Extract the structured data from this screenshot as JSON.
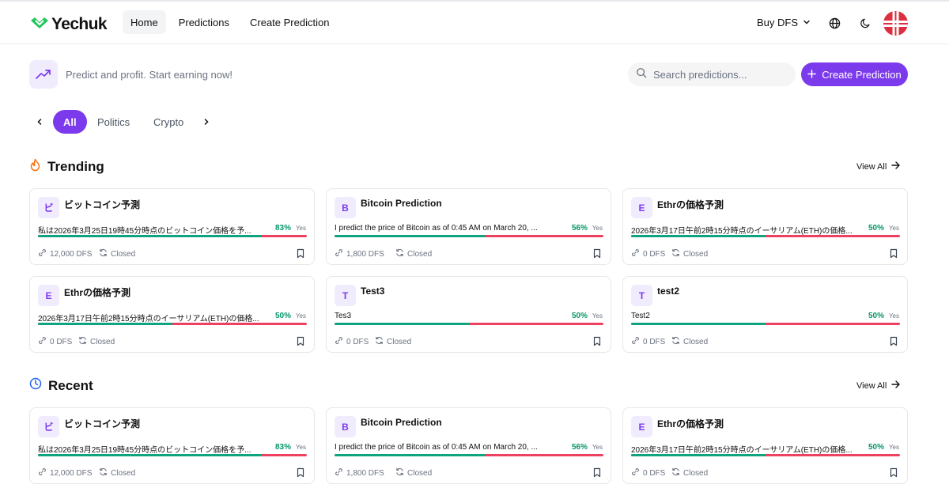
{
  "brand": {
    "name": "Yechuk",
    "accent": "#7c3aed",
    "logo_green": "#22c55e"
  },
  "nav": {
    "items": [
      {
        "label": "Home",
        "active": true
      },
      {
        "label": "Predictions",
        "active": false
      },
      {
        "label": "Create Prediction",
        "active": false
      }
    ],
    "buy_label": "Buy DFS",
    "icons": [
      "chevron-down-icon",
      "globe-icon",
      "moon-icon",
      "avatar"
    ]
  },
  "intro": {
    "tagline": "Predict and profit. Start earning now!",
    "search_placeholder": "Search predictions...",
    "create_label": "Create Prediction"
  },
  "categories": {
    "items": [
      {
        "label": "All",
        "active": true
      },
      {
        "label": "Politics",
        "active": false
      },
      {
        "label": "Crypto",
        "active": false
      }
    ]
  },
  "sections": [
    {
      "title": "Trending",
      "view_all": "View All",
      "icon": "flame-icon",
      "cards": [
        {
          "badge": "ビ",
          "title": "ビットコイン予測",
          "desc": "私は2026年3月25日19時45分時点のビットコイン価格を予...",
          "pct": "83%",
          "yes": "Yes",
          "yes_fraction": 0.83,
          "pool": "12,000 DFS",
          "status": "Closed"
        },
        {
          "badge": "B",
          "title": "Bitcoin Prediction",
          "desc": "I predict the price of Bitcoin as of 0:45 AM on March 20, ...",
          "pct": "56%",
          "yes": "Yes",
          "yes_fraction": 0.56,
          "pool": "1,800 DFS",
          "status": "Closed"
        },
        {
          "badge": "E",
          "title": "Ethrの価格予測",
          "desc": "2026年3月17日午前2時15分時点のイーサリアム(ETH)の価格...",
          "pct": "50%",
          "yes": "Yes",
          "yes_fraction": 0.5,
          "pool": "0 DFS",
          "status": "Closed"
        },
        {
          "badge": "E",
          "title": "Ethrの価格予測",
          "desc": "2026年3月17日午前2時15分時点のイーサリアム(ETH)の価格...",
          "pct": "50%",
          "yes": "Yes",
          "yes_fraction": 0.5,
          "pool": "0 DFS",
          "status": "Closed"
        },
        {
          "badge": "T",
          "title": "Test3",
          "desc": "Tes3",
          "pct": "50%",
          "yes": "Yes",
          "yes_fraction": 0.5,
          "pool": "0 DFS",
          "status": "Closed"
        },
        {
          "badge": "T",
          "title": "test2",
          "desc": "Test2",
          "pct": "50%",
          "yes": "Yes",
          "yes_fraction": 0.5,
          "pool": "0 DFS",
          "status": "Closed"
        }
      ]
    },
    {
      "title": "Recent",
      "view_all": "View All",
      "icon": "clock-icon",
      "cards": [
        {
          "badge": "ビ",
          "title": "ビットコイン予測",
          "desc": "私は2026年3月25日19時45分時点のビットコイン価格を予...",
          "pct": "83%",
          "yes": "Yes",
          "yes_fraction": 0.83,
          "pool": "12,000 DFS",
          "status": "Closed"
        },
        {
          "badge": "B",
          "title": "Bitcoin Prediction",
          "desc": "I predict the price of Bitcoin as of 0:45 AM on March 20, ...",
          "pct": "56%",
          "yes": "Yes",
          "yes_fraction": 0.56,
          "pool": "1,800 DFS",
          "status": "Closed"
        },
        {
          "badge": "E",
          "title": "Ethrの価格予測",
          "desc": "2026年3月17日午前2時15分時点のイーサリアム(ETH)の価格...",
          "pct": "50%",
          "yes": "Yes",
          "yes_fraction": 0.5,
          "pool": "0 DFS",
          "status": "Closed"
        }
      ]
    }
  ]
}
